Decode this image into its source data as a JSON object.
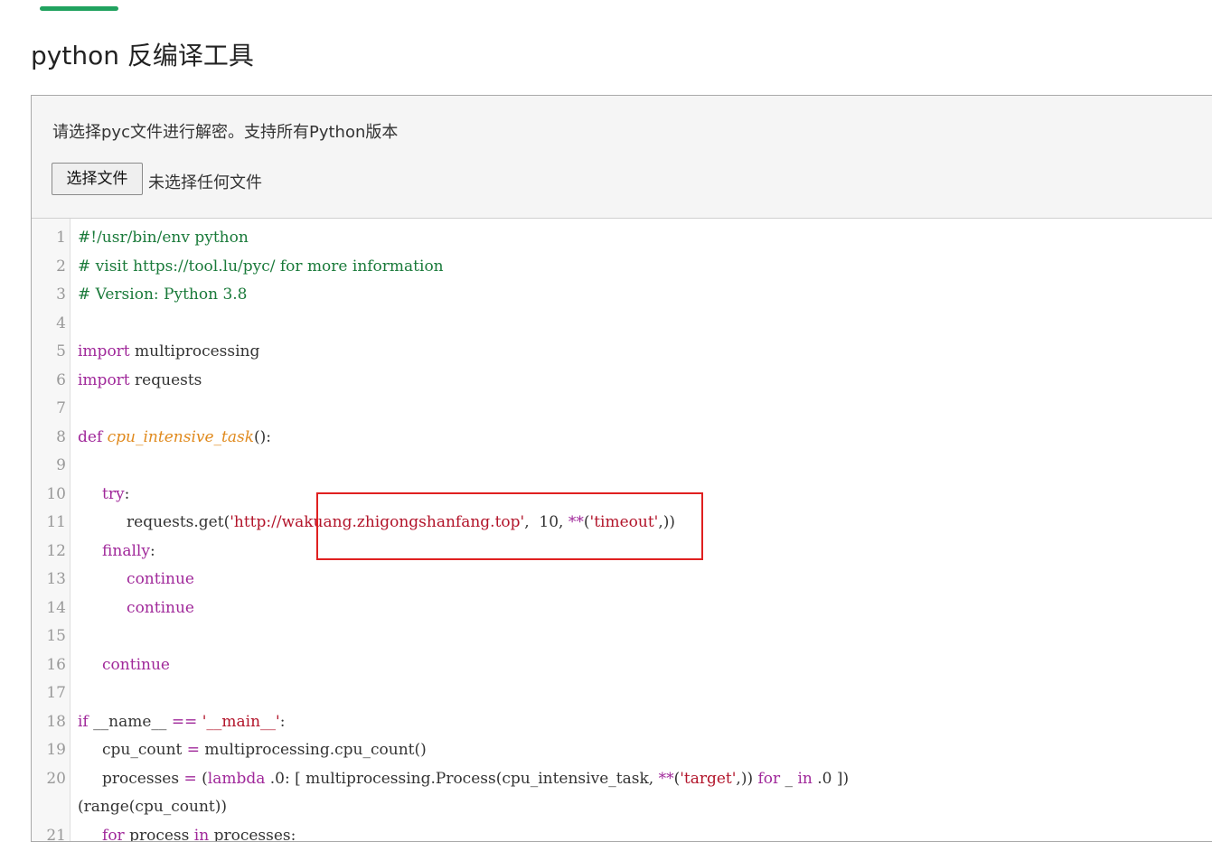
{
  "header": {
    "title": "python 反编译工具"
  },
  "upload": {
    "instructions": "请选择pyc文件进行解密。支持所有Python版本",
    "file_button_label": "选择文件",
    "file_status": "未选择任何文件"
  },
  "editor": {
    "gutter": [
      "1",
      "2",
      "3",
      "4",
      "5",
      "6",
      "7",
      "8",
      "9",
      "10",
      "11",
      "12",
      "13",
      "14",
      "15",
      "16",
      "17",
      "18",
      "19",
      "20",
      "",
      "21"
    ],
    "lines": [
      [
        {
          "c": "cm",
          "t": "#!/usr/bin/env python"
        }
      ],
      [
        {
          "c": "cm",
          "t": "# visit https://tool.lu/pyc/ for more information"
        }
      ],
      [
        {
          "c": "cm",
          "t": "# Version: Python 3.8"
        }
      ],
      [],
      [
        {
          "c": "kw",
          "t": "import"
        },
        {
          "c": "plain",
          "t": " multiprocessing"
        }
      ],
      [
        {
          "c": "kw",
          "t": "import"
        },
        {
          "c": "plain",
          "t": " requests"
        }
      ],
      [],
      [
        {
          "c": "kw",
          "t": "def "
        },
        {
          "c": "fn",
          "t": "cpu_intensive_task"
        },
        {
          "c": "plain",
          "t": "():"
        }
      ],
      [],
      [
        {
          "c": "plain",
          "t": "     "
        },
        {
          "c": "kw",
          "t": "try"
        },
        {
          "c": "plain",
          "t": ":"
        }
      ],
      [
        {
          "c": "plain",
          "t": "          requests.get("
        },
        {
          "c": "str",
          "t": "'http://wakuang.zhigongshanfang.top'"
        },
        {
          "c": "plain",
          "t": ",  10, "
        },
        {
          "c": "kw",
          "t": "**"
        },
        {
          "c": "plain",
          "t": "("
        },
        {
          "c": "str",
          "t": "'timeout'"
        },
        {
          "c": "plain",
          "t": ",))"
        }
      ],
      [
        {
          "c": "plain",
          "t": "     "
        },
        {
          "c": "kw",
          "t": "finally"
        },
        {
          "c": "plain",
          "t": ":"
        }
      ],
      [
        {
          "c": "plain",
          "t": "          "
        },
        {
          "c": "kw",
          "t": "continue"
        }
      ],
      [
        {
          "c": "plain",
          "t": "          "
        },
        {
          "c": "kw",
          "t": "continue"
        }
      ],
      [],
      [
        {
          "c": "plain",
          "t": "     "
        },
        {
          "c": "kw",
          "t": "continue"
        }
      ],
      [],
      [
        {
          "c": "kw",
          "t": "if"
        },
        {
          "c": "plain",
          "t": " __name__ "
        },
        {
          "c": "kw",
          "t": "=="
        },
        {
          "c": "plain",
          "t": " "
        },
        {
          "c": "str",
          "t": "'__main__'"
        },
        {
          "c": "plain",
          "t": ":"
        }
      ],
      [
        {
          "c": "plain",
          "t": "     cpu_count "
        },
        {
          "c": "kw",
          "t": "="
        },
        {
          "c": "plain",
          "t": " multiprocessing.cpu_count()"
        }
      ],
      [
        {
          "c": "plain",
          "t": "     processes "
        },
        {
          "c": "kw",
          "t": "="
        },
        {
          "c": "plain",
          "t": " ("
        },
        {
          "c": "kw",
          "t": "lambda"
        },
        {
          "c": "plain",
          "t": " .0: [ multiprocessing.Process(cpu_intensive_task, "
        },
        {
          "c": "kw",
          "t": "**"
        },
        {
          "c": "plain",
          "t": "("
        },
        {
          "c": "str",
          "t": "'target'"
        },
        {
          "c": "plain",
          "t": ",)) "
        },
        {
          "c": "kw",
          "t": "for"
        },
        {
          "c": "plain",
          "t": " _ "
        },
        {
          "c": "kw",
          "t": "in"
        },
        {
          "c": "plain",
          "t": " .0 ])"
        }
      ],
      [
        {
          "c": "plain",
          "t": "(range(cpu_count))"
        }
      ],
      [
        {
          "c": "plain",
          "t": "     "
        },
        {
          "c": "kw",
          "t": "for"
        },
        {
          "c": "plain",
          "t": " process "
        },
        {
          "c": "kw",
          "t": "in"
        },
        {
          "c": "plain",
          "t": " processes:"
        }
      ]
    ]
  },
  "colors": {
    "accent": "#21a25f",
    "keyword": "#a0289a",
    "comment": "#1a7a3a",
    "string": "#b2142a",
    "function": "#e08a1e",
    "highlight": "#e02020"
  }
}
